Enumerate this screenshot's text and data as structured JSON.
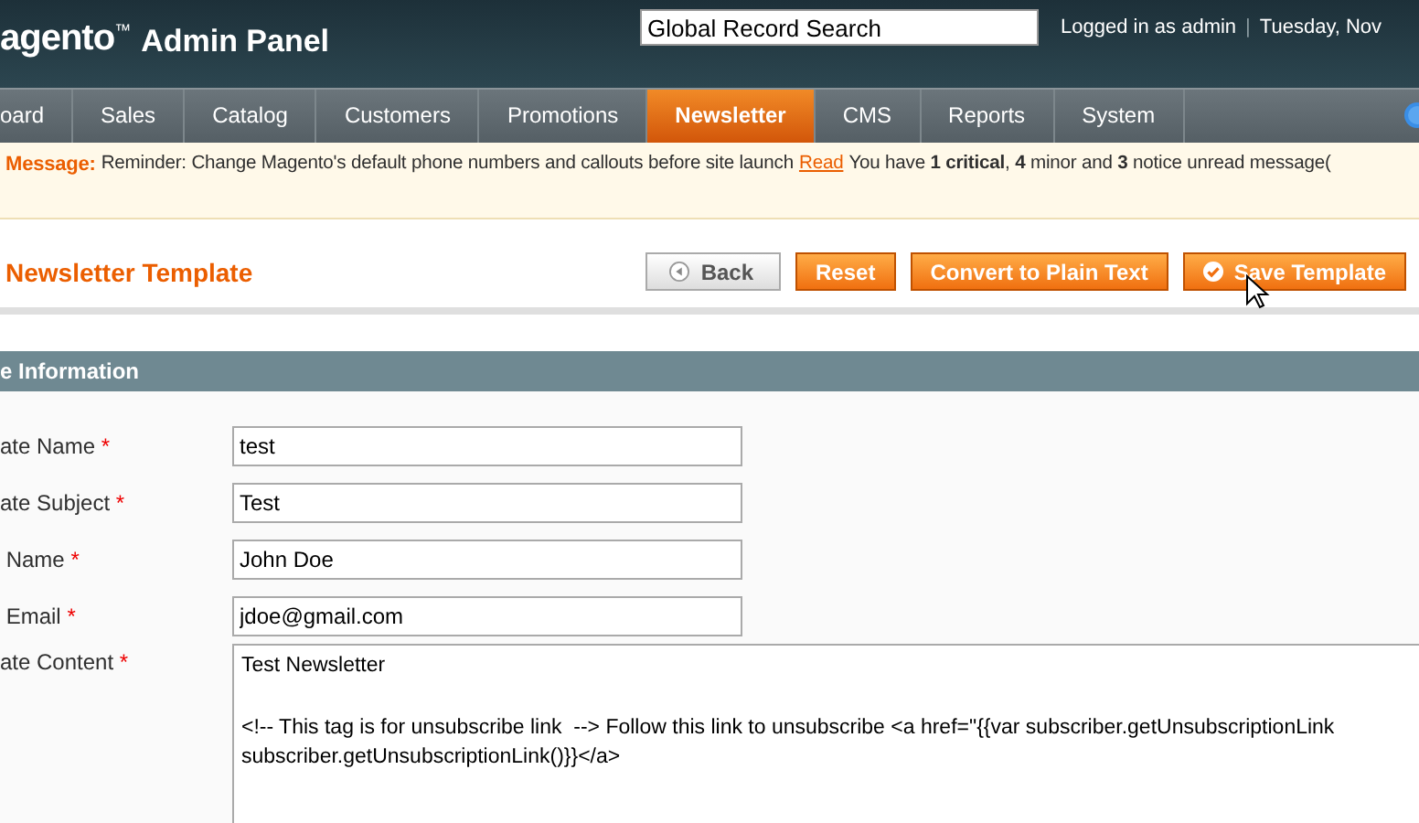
{
  "header": {
    "logo": "agento",
    "logo_mark": "™",
    "title": "Admin Panel",
    "search": {
      "value": "Global Record Search"
    },
    "user": "Logged in as admin",
    "separator": "|",
    "date": "Tuesday, Nov"
  },
  "nav": [
    {
      "label": "oard",
      "selected": false
    },
    {
      "label": "Sales",
      "selected": false
    },
    {
      "label": "Catalog",
      "selected": false
    },
    {
      "label": "Customers",
      "selected": false
    },
    {
      "label": "Promotions",
      "selected": false
    },
    {
      "label": "Newsletter",
      "selected": true
    },
    {
      "label": "CMS",
      "selected": false
    },
    {
      "label": "Reports",
      "selected": false
    },
    {
      "label": "System",
      "selected": false
    }
  ],
  "message": {
    "label": "Message:",
    "text": "Reminder: Change Magento's default phone numbers and callouts before site launch",
    "link": "Read",
    "tail": "You have **1 critical**, **4** minor and **3** notice unread message("
  },
  "page": {
    "title": "Newsletter Template",
    "buttons": [
      {
        "label": "Back",
        "kind": "back"
      },
      {
        "label": "Reset",
        "kind": "action"
      },
      {
        "label": "Convert to Plain Text",
        "kind": "action"
      },
      {
        "label": "Save Template",
        "kind": "save"
      }
    ]
  },
  "section": {
    "title": "e Information",
    "fields": [
      {
        "label": "ate Name",
        "required_mark": "*",
        "value": "test"
      },
      {
        "label": "ate Subject",
        "required_mark": "*",
        "value": "Test"
      },
      {
        "label": " Name",
        "required_mark": "*",
        "value": "John Doe"
      },
      {
        "label": " Email",
        "required_mark": "*",
        "value": "jdoe@gmail.com"
      }
    ],
    "content": {
      "label": "ate Content",
      "required_mark": "*",
      "paragraphs": [
        "Test Newsletter",
        "<!-- This tag is for unsubscribe link  --> Follow this link to unsubscribe <a href=\"{{var subscriber.getUnsubscriptionLink\nsubscriber.getUnsubscriptionLink()}}</a>"
      ]
    }
  }
}
